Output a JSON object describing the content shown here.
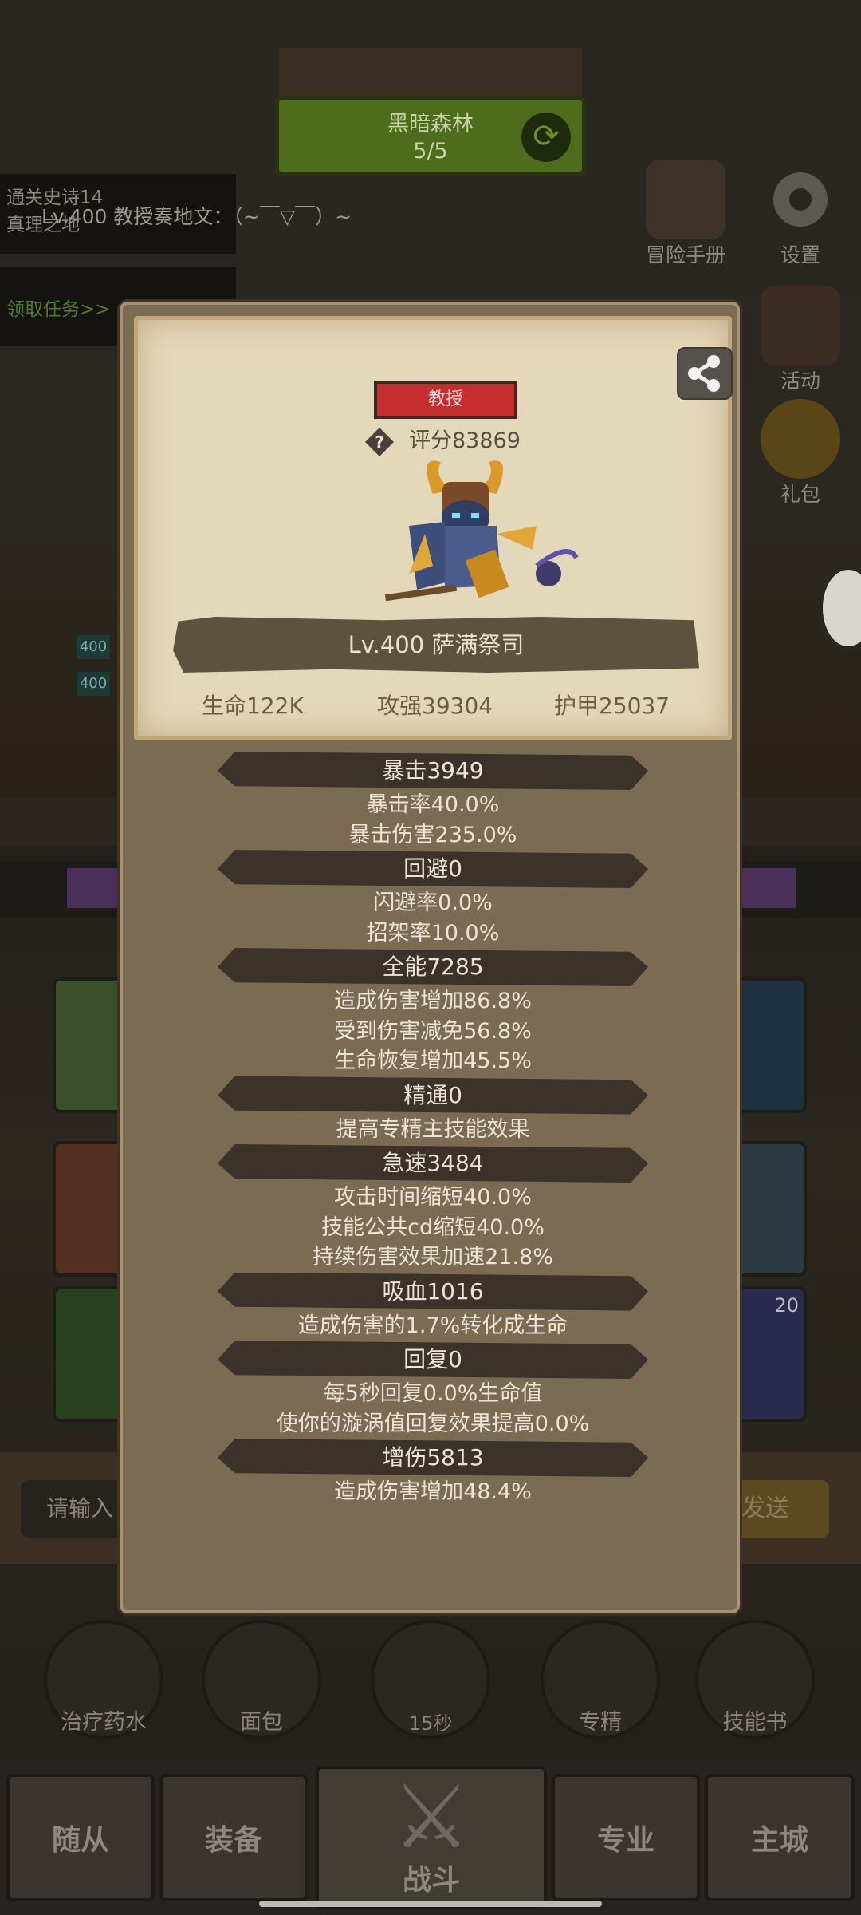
{
  "background": {
    "level_banner": {
      "title": "黑暗森林",
      "progress": "5/5"
    },
    "quest_panel": {
      "line1": "通关史诗14",
      "line2": "真理之地",
      "claim": "领取任务>>"
    },
    "marquee": "Lv.400 教授奏地文：（~￣▽￣）~",
    "side_buttons": [
      "冒险手册",
      "设置",
      "活动",
      "礼包"
    ],
    "mini_level_tags": [
      "400",
      "400"
    ],
    "slot_count": "20",
    "chat_input_placeholder": "请输入",
    "send_button": "发送",
    "items": [
      "治疗药水",
      "面包",
      "15秒",
      "专精",
      "技能书"
    ],
    "tabs": [
      "随从",
      "装备",
      "战斗",
      "专业",
      "主城"
    ]
  },
  "card": {
    "rank": "教授",
    "score_label": "评分83869",
    "name": "Lv.400 萨满祭司",
    "stats": [
      {
        "key": "health",
        "text": "生命122K"
      },
      {
        "key": "attack",
        "text": "攻强39304"
      },
      {
        "key": "armor",
        "text": "护甲25037"
      }
    ]
  },
  "attributes": [
    {
      "header": "暴击3949",
      "lines": [
        "暴击率40.0%",
        "暴击伤害235.0%"
      ]
    },
    {
      "header": "回避0",
      "lines": [
        "闪避率0.0%",
        "招架率10.0%"
      ]
    },
    {
      "header": "全能7285",
      "lines": [
        "造成伤害增加86.8%",
        "受到伤害减免56.8%",
        "生命恢复增加45.5%"
      ]
    },
    {
      "header": "精通0",
      "lines": [
        "提高专精主技能效果"
      ]
    },
    {
      "header": "急速3484",
      "lines": [
        "攻击时间缩短40.0%",
        "技能公共cd缩短40.0%",
        "持续伤害效果加速21.8%"
      ]
    },
    {
      "header": "吸血1016",
      "lines": [
        "造成伤害的1.7%转化成生命"
      ]
    },
    {
      "header": "回复0",
      "lines": [
        "每5秒回复0.0%生命值",
        "使你的漩涡值回复效果提高0.0%"
      ]
    },
    {
      "header": "增伤5813",
      "lines": [
        "造成伤害增加48.4%"
      ]
    }
  ]
}
